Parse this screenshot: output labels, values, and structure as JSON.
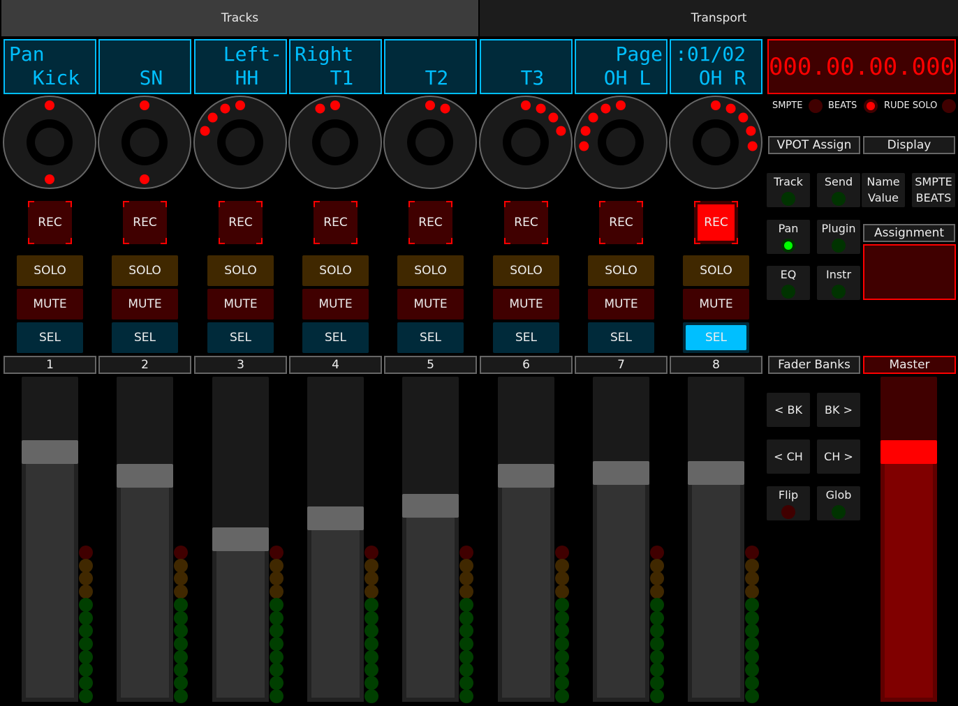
{
  "tabs": [
    {
      "label": "Tracks",
      "active": true
    },
    {
      "label": "Transport",
      "active": false
    }
  ],
  "colors": {
    "lcd": "#00bfff",
    "rec": "#ff0000",
    "solo": "#402800",
    "mute": "#400000",
    "sel": "#002a3a",
    "sel_on": "#00bfff",
    "meter_red": "#400000",
    "meter_orange": "#402800",
    "meter_green": "#003f00"
  },
  "strips": [
    {
      "line1": "Pan    ",
      "line2": "  Kick ",
      "number": "1",
      "ring": [
        0
      ],
      "center": true,
      "rec": "REC",
      "solo": "SOLO",
      "mute": "MUTE",
      "sel": "SEL",
      "rec_on": false,
      "sel_on": false,
      "fader": 0.79
    },
    {
      "line1": "       ",
      "line2": "   SN  ",
      "number": "2",
      "ring": [
        0
      ],
      "center": true,
      "rec": "REC",
      "solo": "SOLO",
      "mute": "MUTE",
      "sel": "SEL",
      "rec_on": false,
      "sel_on": false,
      "fader": 0.71
    },
    {
      "line1": "  Left-",
      "line2": "   HH  ",
      "number": "3",
      "ring": [
        -3,
        -2,
        -1,
        0
      ],
      "center": false,
      "rec": "REC",
      "solo": "SOLO",
      "mute": "MUTE",
      "sel": "SEL",
      "rec_on": false,
      "sel_on": false,
      "fader": 0.5
    },
    {
      "line1": "Right  ",
      "line2": "   T1  ",
      "number": "4",
      "ring": [
        -1,
        0
      ],
      "center": false,
      "rec": "REC",
      "solo": "SOLO",
      "mute": "MUTE",
      "sel": "SEL",
      "rec_on": false,
      "sel_on": false,
      "fader": 0.57
    },
    {
      "line1": "       ",
      "line2": "   T2  ",
      "number": "5",
      "ring": [
        0,
        1
      ],
      "center": false,
      "rec": "REC",
      "solo": "SOLO",
      "mute": "MUTE",
      "sel": "SEL",
      "rec_on": false,
      "sel_on": false,
      "fader": 0.61
    },
    {
      "line1": "       ",
      "line2": "   T3  ",
      "number": "6",
      "ring": [
        0,
        1,
        2,
        3
      ],
      "center": false,
      "rec": "REC",
      "solo": "SOLO",
      "mute": "MUTE",
      "sel": "SEL",
      "rec_on": false,
      "sel_on": false,
      "fader": 0.71
    },
    {
      "line1": "   Page",
      "line2": "  OH L ",
      "number": "7",
      "ring": [
        -4,
        -3,
        -2,
        -1,
        0
      ],
      "center": false,
      "rec": "REC",
      "solo": "SOLO",
      "mute": "MUTE",
      "sel": "SEL",
      "rec_on": false,
      "sel_on": false,
      "fader": 0.72
    },
    {
      "line1": ":01/02 ",
      "line2": "  OH R ",
      "number": "8",
      "ring": [
        0,
        1,
        2,
        3,
        4
      ],
      "center": false,
      "rec": "REC",
      "solo": "SOLO",
      "mute": "MUTE",
      "sel": "SEL",
      "rec_on": true,
      "sel_on": true,
      "fader": 0.72
    }
  ],
  "transport": {
    "timecode": "000.00.00.000",
    "indicators": [
      {
        "label": "SMPTE",
        "on": false
      },
      {
        "label": "BEATS",
        "on": true
      },
      {
        "label": "RUDE SOLO",
        "on": false
      }
    ],
    "vpot_header": "VPOT Assign",
    "display_header": "Display",
    "vpot_buttons": [
      {
        "label": "Track",
        "on": false
      },
      {
        "label": "Send",
        "on": false
      },
      {
        "label": "Pan",
        "on": true
      },
      {
        "label": "Plugin",
        "on": false
      },
      {
        "label": "EQ",
        "on": false
      },
      {
        "label": "Instr",
        "on": false
      }
    ],
    "display_buttons": [
      {
        "line1": "Name",
        "line2": "Value"
      },
      {
        "line1": "SMPTE",
        "line2": "BEATS"
      }
    ],
    "assignment_header": "Assignment",
    "assignment_value": "",
    "fader_banks_header": "Fader Banks",
    "bank_buttons": [
      {
        "label": "< BK"
      },
      {
        "label": "BK >"
      },
      {
        "label": "< CH"
      },
      {
        "label": "CH >"
      }
    ],
    "flip": {
      "label": "Flip",
      "on": false
    },
    "glob": {
      "label": "Glob",
      "on": false
    },
    "master_header": "Master",
    "master_fader": 0.79
  }
}
